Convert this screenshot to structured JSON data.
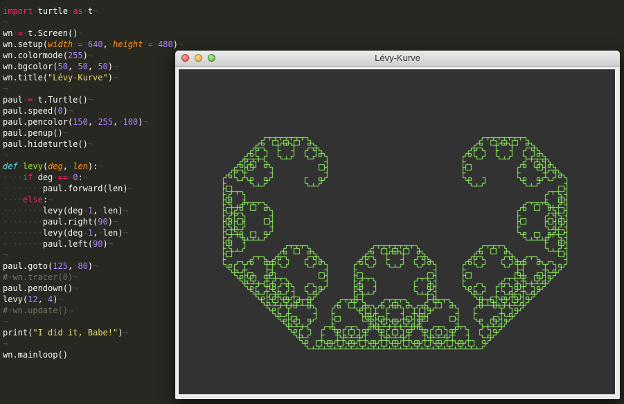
{
  "editor": {
    "lines": [
      [
        [
          "kw",
          "import"
        ],
        [
          "inv",
          "·"
        ],
        [
          "txt",
          "turtle"
        ],
        [
          "inv",
          "·"
        ],
        [
          "kw",
          "as"
        ],
        [
          "inv",
          "·"
        ],
        [
          "txt",
          "t"
        ],
        [
          "inv",
          "¬"
        ]
      ],
      [
        [
          "inv",
          "¬"
        ]
      ],
      [
        [
          "txt",
          "wn"
        ],
        [
          "inv",
          "·"
        ],
        [
          "op",
          "="
        ],
        [
          "inv",
          "·"
        ],
        [
          "txt",
          "t.Screen()"
        ],
        [
          "inv",
          "¬"
        ]
      ],
      [
        [
          "txt",
          "wn.setup("
        ],
        [
          "param",
          "width"
        ],
        [
          "inv",
          "·"
        ],
        [
          "op",
          "="
        ],
        [
          "inv",
          "·"
        ],
        [
          "num",
          "640"
        ],
        [
          "txt",
          ","
        ],
        [
          "inv",
          "·"
        ],
        [
          "param",
          "height"
        ],
        [
          "inv",
          "·"
        ],
        [
          "op",
          "="
        ],
        [
          "inv",
          "·"
        ],
        [
          "num",
          "480"
        ],
        [
          "txt",
          ")"
        ],
        [
          "inv",
          "¬"
        ]
      ],
      [
        [
          "txt",
          "wn.colormode("
        ],
        [
          "num",
          "255"
        ],
        [
          "txt",
          ")"
        ],
        [
          "inv",
          "¬"
        ]
      ],
      [
        [
          "txt",
          "wn.bgcolor("
        ],
        [
          "num",
          "50"
        ],
        [
          "txt",
          ","
        ],
        [
          "inv",
          "·"
        ],
        [
          "num",
          "50"
        ],
        [
          "txt",
          ","
        ],
        [
          "inv",
          "·"
        ],
        [
          "num",
          "50"
        ],
        [
          "txt",
          ")"
        ],
        [
          "inv",
          "¬"
        ]
      ],
      [
        [
          "txt",
          "wn.title("
        ],
        [
          "str",
          "\"Lévy-Kurve\""
        ],
        [
          "txt",
          ")"
        ],
        [
          "inv",
          "¬"
        ]
      ],
      [
        [
          "inv",
          "¬"
        ]
      ],
      [
        [
          "txt",
          "paul"
        ],
        [
          "inv",
          "·"
        ],
        [
          "op",
          "="
        ],
        [
          "inv",
          "·"
        ],
        [
          "txt",
          "t.Turtle()"
        ],
        [
          "inv",
          "¬"
        ]
      ],
      [
        [
          "txt",
          "paul.speed("
        ],
        [
          "num",
          "0"
        ],
        [
          "txt",
          ")"
        ],
        [
          "inv",
          "¬"
        ]
      ],
      [
        [
          "txt",
          "paul.pencolor("
        ],
        [
          "num",
          "150"
        ],
        [
          "txt",
          ","
        ],
        [
          "inv",
          "·"
        ],
        [
          "num",
          "255"
        ],
        [
          "txt",
          ","
        ],
        [
          "inv",
          "·"
        ],
        [
          "num",
          "100"
        ],
        [
          "txt",
          ")"
        ],
        [
          "inv",
          "¬"
        ]
      ],
      [
        [
          "txt",
          "paul.penup()"
        ],
        [
          "inv",
          "¬"
        ]
      ],
      [
        [
          "txt",
          "paul.hideturtle()"
        ],
        [
          "inv",
          "¬"
        ]
      ],
      [
        [
          "inv",
          "¬"
        ]
      ],
      [
        [
          "def",
          "def"
        ],
        [
          "inv",
          "·"
        ],
        [
          "fn",
          "levy"
        ],
        [
          "txt",
          "("
        ],
        [
          "param",
          "deg"
        ],
        [
          "txt",
          ","
        ],
        [
          "inv",
          "·"
        ],
        [
          "param",
          "len"
        ],
        [
          "txt",
          "):"
        ],
        [
          "inv",
          "¬"
        ]
      ],
      [
        [
          "inv",
          "····"
        ],
        [
          "kw",
          "if"
        ],
        [
          "inv",
          "·"
        ],
        [
          "txt",
          "deg"
        ],
        [
          "inv",
          "·"
        ],
        [
          "op",
          "=="
        ],
        [
          "inv",
          "·"
        ],
        [
          "num",
          "0"
        ],
        [
          "txt",
          ":"
        ],
        [
          "inv",
          "¬"
        ]
      ],
      [
        [
          "inv",
          "········"
        ],
        [
          "txt",
          "paul.forward(len)"
        ],
        [
          "inv",
          "¬"
        ]
      ],
      [
        [
          "inv",
          "····"
        ],
        [
          "kw",
          "else"
        ],
        [
          "txt",
          ":"
        ],
        [
          "inv",
          "¬"
        ]
      ],
      [
        [
          "inv",
          "········"
        ],
        [
          "txt",
          "levy(deg"
        ],
        [
          "op",
          "-"
        ],
        [
          "num",
          "1"
        ],
        [
          "txt",
          ","
        ],
        [
          "inv",
          "·"
        ],
        [
          "txt",
          "len)"
        ],
        [
          "inv",
          "¬"
        ]
      ],
      [
        [
          "inv",
          "········"
        ],
        [
          "txt",
          "paul.right("
        ],
        [
          "num",
          "90"
        ],
        [
          "txt",
          ")"
        ],
        [
          "inv",
          "¬"
        ]
      ],
      [
        [
          "inv",
          "········"
        ],
        [
          "txt",
          "levy(deg"
        ],
        [
          "op",
          "-"
        ],
        [
          "num",
          "1"
        ],
        [
          "txt",
          ","
        ],
        [
          "inv",
          "·"
        ],
        [
          "txt",
          "len)"
        ],
        [
          "inv",
          "¬"
        ]
      ],
      [
        [
          "inv",
          "········"
        ],
        [
          "txt",
          "paul.left("
        ],
        [
          "num",
          "90"
        ],
        [
          "txt",
          ")"
        ],
        [
          "inv",
          "¬"
        ]
      ],
      [
        [
          "inv",
          "¬"
        ]
      ],
      [
        [
          "txt",
          "paul.goto("
        ],
        [
          "num",
          "125"
        ],
        [
          "txt",
          ","
        ],
        [
          "inv",
          "·"
        ],
        [
          "num",
          "80"
        ],
        [
          "txt",
          ")"
        ],
        [
          "inv",
          "¬"
        ]
      ],
      [
        [
          "com",
          "#·wn.tracer(0)"
        ],
        [
          "inv",
          "¬"
        ]
      ],
      [
        [
          "txt",
          "paul.pendown()"
        ],
        [
          "inv",
          "¬"
        ]
      ],
      [
        [
          "txt",
          "levy("
        ],
        [
          "num",
          "12"
        ],
        [
          "txt",
          ","
        ],
        [
          "inv",
          "·"
        ],
        [
          "num",
          "4"
        ],
        [
          "txt",
          ")"
        ],
        [
          "inv",
          "¬"
        ]
      ],
      [
        [
          "com",
          "#·wn.update()"
        ],
        [
          "inv",
          "¬"
        ]
      ],
      [
        [
          "inv",
          "¬"
        ]
      ],
      [
        [
          "txt",
          "print("
        ],
        [
          "str",
          "\"I did it, Babe!\""
        ],
        [
          "txt",
          ")"
        ],
        [
          "inv",
          "¬"
        ]
      ],
      [
        [
          "inv",
          "¬"
        ]
      ],
      [
        [
          "txt",
          "wn.mainloop()"
        ]
      ]
    ]
  },
  "window": {
    "title": "Lévy-Kurve",
    "bg_color": "#323232",
    "pen_color": "#96ff64",
    "controls": [
      "close",
      "minimize",
      "maximize"
    ]
  },
  "turtle": {
    "start": [
      125,
      80
    ],
    "levy_depth": 12,
    "segment_len": 4
  }
}
